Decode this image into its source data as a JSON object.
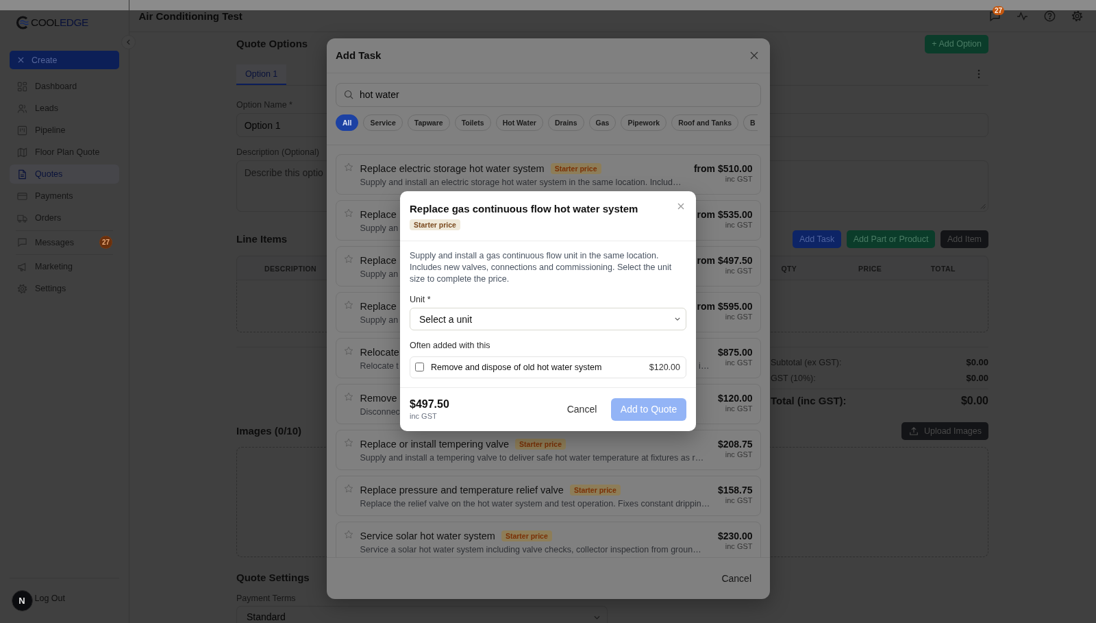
{
  "header": {
    "title": "Air Conditioning Test",
    "message_count": "27"
  },
  "sidebar": {
    "logo": {
      "first": "COOL",
      "second": "EDGE"
    },
    "create_button": "Create",
    "nav_groups": [
      {
        "items": [
          {
            "label": "Dashboard",
            "selected": false
          },
          {
            "label": "Leads",
            "selected": false
          },
          {
            "label": "Pipeline",
            "selected": false
          },
          {
            "label": "Floor Plan Quote",
            "selected": false
          },
          {
            "label": "Quotes",
            "selected": true
          },
          {
            "label": "Payments",
            "selected": false
          },
          {
            "label": "Orders",
            "selected": false
          }
        ]
      },
      {
        "items": [
          {
            "label": "Messages",
            "selected": false,
            "badge": "27"
          }
        ]
      },
      {
        "items": [
          {
            "label": "Marketing",
            "selected": false
          },
          {
            "label": "Settings",
            "selected": false
          }
        ]
      }
    ],
    "logout": "Log Out"
  },
  "floating_badge": "N",
  "quote_options": {
    "title": "Quote Options",
    "add_option_button": "+ Add Option",
    "tabs": [
      {
        "label": "Option 1",
        "selected": true
      }
    ],
    "option_name": {
      "label": "Option Name *",
      "value": "Option 1"
    },
    "description": {
      "label": "Description (Optional)",
      "placeholder": "Describe this optio"
    }
  },
  "line_items": {
    "title": "Line Items",
    "buttons": [
      {
        "label": "Add Task",
        "kind": "primary"
      },
      {
        "label": "Add Part or Product",
        "kind": "success"
      },
      {
        "label": "Add Item",
        "kind": "dark"
      }
    ],
    "columns": [
      "DESCRIPTION",
      "QTY",
      "PRICE",
      "TOTAL"
    ]
  },
  "totals": [
    {
      "label": "Subtotal (ex GST):",
      "value": "$0.00",
      "kind": "line"
    },
    {
      "label": "GST (10%):",
      "value": "$0.00",
      "kind": "line"
    },
    {
      "label": "Total (inc GST):",
      "value": "$0.00",
      "kind": "grand"
    }
  ],
  "images": {
    "title": "Images (0/10)",
    "upload_button": "Upload Images"
  },
  "quote_settings": {
    "title": "Quote Settings",
    "payment_terms": {
      "label": "Payment Terms",
      "value": "Standard"
    }
  },
  "add_task_dialog": {
    "title": "Add Task",
    "search": {
      "value": "hot water"
    },
    "categories": [
      {
        "label": "All",
        "selected": true
      },
      {
        "label": "Service",
        "selected": false
      },
      {
        "label": "Tapware",
        "selected": false
      },
      {
        "label": "Toilets",
        "selected": false
      },
      {
        "label": "Hot Water",
        "selected": false
      },
      {
        "label": "Drains",
        "selected": false
      },
      {
        "label": "Gas",
        "selected": false
      },
      {
        "label": "Pipework",
        "selected": false
      },
      {
        "label": "Roof and Tanks",
        "selected": false
      },
      {
        "label": "B",
        "selected": false
      }
    ],
    "tasks": [
      {
        "title": "Replace electric storage hot water system",
        "badge": "Starter price",
        "description": "Supply and install an electric storage hot water system in the same location. Includ…",
        "price": "from $510.00",
        "price_note": "inc GST"
      },
      {
        "title": "Replace",
        "description": "Supply an",
        "price": "rom $535.00",
        "price_note": "inc GST"
      },
      {
        "title": "Replace",
        "description": "Supply an",
        "price": "rom $497.50",
        "price_note": "inc GST"
      },
      {
        "title": "Replace",
        "description": "Supply an",
        "price": "rom $595.00",
        "price_note": "inc GST"
      },
      {
        "title": "Relocate",
        "description": "Relocate t",
        "description_tail": "i…",
        "price": "$875.00",
        "price_note": "inc GST"
      },
      {
        "title": "Remove",
        "description": "Disconnec",
        "price": "$120.00",
        "price_note": "inc GST"
      },
      {
        "title": "Replace or install tempering valve",
        "badge": "Starter price",
        "description": "Supply and install a tempering valve to deliver safe hot water temperature at fixtures as r…",
        "price": "$208.75",
        "price_note": "inc GST"
      },
      {
        "title": "Replace pressure and temperature relief valve",
        "badge": "Starter price",
        "description": "Replace the relief valve on the hot water system and test operation. Fixes constant drippin…",
        "price": "$158.75",
        "price_note": "inc GST"
      },
      {
        "title": "Service solar hot water system",
        "badge": "Starter price",
        "description": "Service a solar hot water system including valve checks, collector inspection from groun…",
        "price": "$230.00",
        "price_note": "inc GST"
      }
    ],
    "cancel_button": "Cancel"
  },
  "task_detail_dialog": {
    "title": "Replace gas continuous flow hot water system",
    "badge": "Starter price",
    "description": "Supply and install a gas continuous flow unit in the same location. Includes new valves, connections and commissioning. Select the unit size to complete the price.",
    "unit": {
      "label": "Unit *",
      "value": "Select a unit"
    },
    "addons_title": "Often added with this",
    "addons": [
      {
        "label": "Remove and dispose of old hot water system",
        "price": "$120.00",
        "checked": false
      }
    ],
    "total": {
      "price": "$497.50",
      "note": "inc GST"
    },
    "cancel_button": "Cancel",
    "confirm_button": {
      "label": "Add to Quote",
      "disabled": true
    }
  }
}
